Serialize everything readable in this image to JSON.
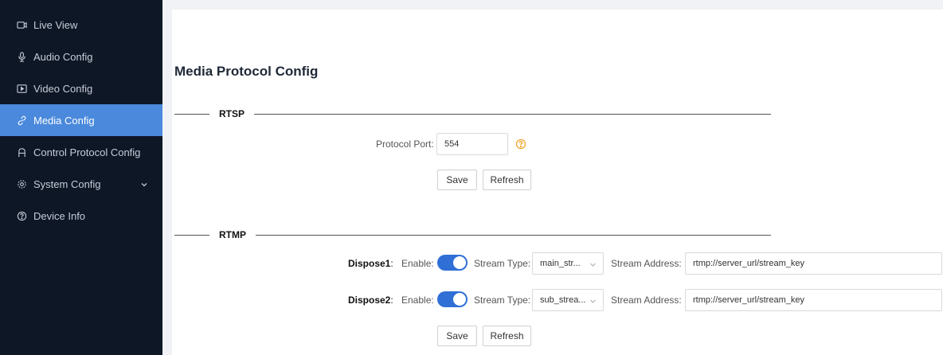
{
  "sidebar": {
    "items": [
      {
        "label": "Live View",
        "icon": "video-camera-icon"
      },
      {
        "label": "Audio Config",
        "icon": "microphone-icon"
      },
      {
        "label": "Video Config",
        "icon": "screen-play-icon"
      },
      {
        "label": "Media Config",
        "icon": "link-icon",
        "active": true
      },
      {
        "label": "Control Protocol Config",
        "icon": "protocol-icon"
      },
      {
        "label": "System Config",
        "icon": "gear-icon",
        "has_submenu": true
      },
      {
        "label": "Device Info",
        "icon": "question-circle-icon"
      }
    ]
  },
  "page": {
    "title": "Media Protocol Config"
  },
  "rtsp": {
    "section_label": "RTSP",
    "port_label": "Protocol Port:",
    "port_value": "554",
    "save_label": "Save",
    "refresh_label": "Refresh"
  },
  "rtmp": {
    "section_label": "RTMP",
    "dispose": [
      {
        "name": "Dispose1",
        "colon": ":",
        "enable_label": "Enable:",
        "enabled": true,
        "stream_type_label": "Stream Type:",
        "stream_type_value": "main_str...",
        "stream_address_label": "Stream Address:",
        "stream_address_value": "rtmp://server_url/stream_key"
      },
      {
        "name": "Dispose2",
        "colon": ":",
        "enable_label": "Enable:",
        "enabled": true,
        "stream_type_label": "Stream Type:",
        "stream_type_value": "sub_strea...",
        "stream_address_label": "Stream Address:",
        "stream_address_value": "rtmp://server_url/stream_key"
      }
    ],
    "save_label": "Save",
    "refresh_label": "Refresh"
  },
  "colors": {
    "sidebar_bg": "#0e1726",
    "active_item": "#4a89dc",
    "toggle_on": "#2f6fd6",
    "help_icon": "#f0a020"
  }
}
